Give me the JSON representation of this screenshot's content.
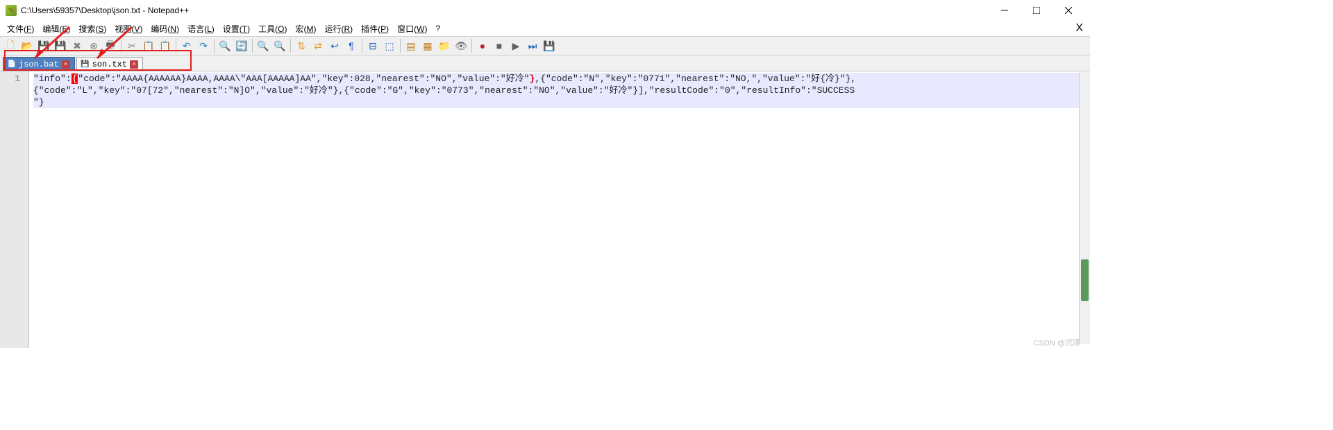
{
  "window": {
    "title": "C:\\Users\\59357\\Desktop\\json.txt - Notepad++"
  },
  "menu": {
    "items": [
      {
        "label": "文件",
        "accel": "F"
      },
      {
        "label": "编辑",
        "accel": "E"
      },
      {
        "label": "搜索",
        "accel": "S"
      },
      {
        "label": "视图",
        "accel": "V"
      },
      {
        "label": "编码",
        "accel": "N"
      },
      {
        "label": "语言",
        "accel": "L"
      },
      {
        "label": "设置",
        "accel": "T"
      },
      {
        "label": "工具",
        "accel": "O"
      },
      {
        "label": "宏",
        "accel": "M"
      },
      {
        "label": "运行",
        "accel": "R"
      },
      {
        "label": "插件",
        "accel": "P"
      },
      {
        "label": "窗口",
        "accel": "W"
      },
      {
        "label": "?",
        "accel": ""
      }
    ]
  },
  "toolbar": {
    "buttons": [
      {
        "name": "new-file-icon",
        "glyph": "🗋",
        "color": "#e0a030"
      },
      {
        "name": "open-file-icon",
        "glyph": "📂",
        "color": "#e0a030"
      },
      {
        "name": "save-icon",
        "glyph": "💾",
        "color": "#4060c0"
      },
      {
        "name": "save-all-icon",
        "glyph": "💾",
        "color": "#4060c0"
      },
      {
        "name": "close-icon",
        "glyph": "✖",
        "color": "#808080"
      },
      {
        "name": "close-all-icon",
        "glyph": "⊗",
        "color": "#808080"
      },
      {
        "name": "print-icon",
        "glyph": "🖶",
        "color": "#606060"
      },
      {
        "sep": true
      },
      {
        "name": "cut-icon",
        "glyph": "✂",
        "color": "#808080"
      },
      {
        "name": "copy-icon",
        "glyph": "📋",
        "color": "#e0a030"
      },
      {
        "name": "paste-icon",
        "glyph": "📋",
        "color": "#e0a030"
      },
      {
        "sep": true
      },
      {
        "name": "undo-icon",
        "glyph": "↶",
        "color": "#2080c0"
      },
      {
        "name": "redo-icon",
        "glyph": "↷",
        "color": "#2080c0"
      },
      {
        "sep": true
      },
      {
        "name": "find-icon",
        "glyph": "🔍",
        "color": "#606060"
      },
      {
        "name": "replace-icon",
        "glyph": "🔄",
        "color": "#606060"
      },
      {
        "sep": true
      },
      {
        "name": "zoom-in-icon",
        "glyph": "🔍",
        "color": "#20a020"
      },
      {
        "name": "zoom-out-icon",
        "glyph": "🔍",
        "color": "#c02020"
      },
      {
        "sep": true
      },
      {
        "name": "sync-v-icon",
        "glyph": "⇅",
        "color": "#e0a030"
      },
      {
        "name": "sync-h-icon",
        "glyph": "⇄",
        "color": "#e0a030"
      },
      {
        "name": "wrap-icon",
        "glyph": "↩",
        "color": "#2060c0"
      },
      {
        "name": "all-chars-icon",
        "glyph": "¶",
        "color": "#2060c0"
      },
      {
        "sep": true
      },
      {
        "name": "indent-guide-icon",
        "glyph": "⊟",
        "color": "#2060c0"
      },
      {
        "name": "lang-icon",
        "glyph": "⬚",
        "color": "#2060c0"
      },
      {
        "sep": true
      },
      {
        "name": "doc-map-icon",
        "glyph": "▤",
        "color": "#c08020"
      },
      {
        "name": "func-list-icon",
        "glyph": "▦",
        "color": "#c08020"
      },
      {
        "name": "folder-icon",
        "glyph": "📁",
        "color": "#e0a030"
      },
      {
        "name": "monitor-icon",
        "glyph": "👁",
        "color": "#606060"
      },
      {
        "sep": true
      },
      {
        "name": "record-icon",
        "glyph": "●",
        "color": "#c02020"
      },
      {
        "name": "stop-icon",
        "glyph": "■",
        "color": "#606060"
      },
      {
        "name": "play-icon",
        "glyph": "▶",
        "color": "#606060"
      },
      {
        "name": "play-multi-icon",
        "glyph": "⏭",
        "color": "#2060c0"
      },
      {
        "name": "save-macro-icon",
        "glyph": "💾",
        "color": "#2060c0"
      }
    ]
  },
  "tabs": [
    {
      "name": "json.bat",
      "active": false,
      "icon": "file-icon"
    },
    {
      "name": "son.txt",
      "active": true,
      "icon": "save-icon"
    }
  ],
  "editor": {
    "line_number": "1",
    "line1_prefix": "\"info\":",
    "line1_brace_open": "{",
    "line1_mid": "\"code\":\"AAAA{AAAAAA}AAAA,AAAA\\\"AAA[AAAAA]AA\",\"key\":028,\"nearest\":\"NO\",\"value\":\"好冷\"",
    "line1_brace_close": "}",
    "line1_suffix": ",{\"code\":\"N\",\"key\":\"0771\",\"nearest\":\"NO,\",\"value\":\"好{冷}\"},",
    "line2": "{\"code\":\"L\",\"key\":\"07[72\",\"nearest\":\"N]O\",\"value\":\"好冷\"},{\"code\":\"G\",\"key\":\"0773\",\"nearest\":\"NO\",\"value\":\"好冷\"}],\"resultCode\":\"0\",\"resultInfo\":\"SUCCESS",
    "line3": "\"}"
  },
  "watermark": "CSDN @沉泽"
}
